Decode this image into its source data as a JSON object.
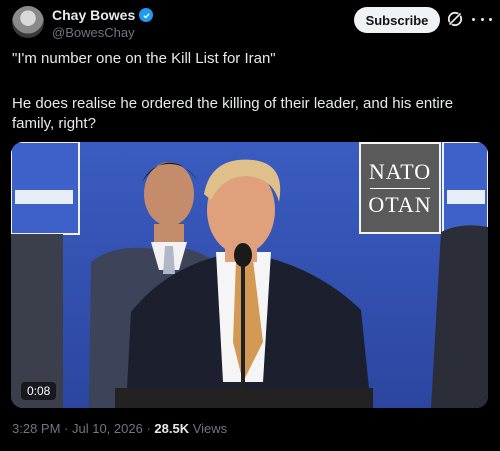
{
  "author": {
    "name": "Chay Bowes",
    "handle": "@BowesChay"
  },
  "actions": {
    "subscribe_label": "Subscribe"
  },
  "post": {
    "line1": "\"I'm number one on the Kill List for Iran\"",
    "line2": "He does realise he ordered the killing of their leader, and his entire family, right?"
  },
  "media": {
    "duration": "0:08",
    "sign_top": "NATO",
    "sign_bottom": "OTAN"
  },
  "meta": {
    "time": "3:28 PM",
    "separator": " · ",
    "date": "Jul 10, 2026",
    "views_count": "28.5K",
    "views_label": " Views"
  },
  "colors": {
    "verified": "#1d9bf0",
    "muted": "#71767b",
    "background": "#000000"
  }
}
